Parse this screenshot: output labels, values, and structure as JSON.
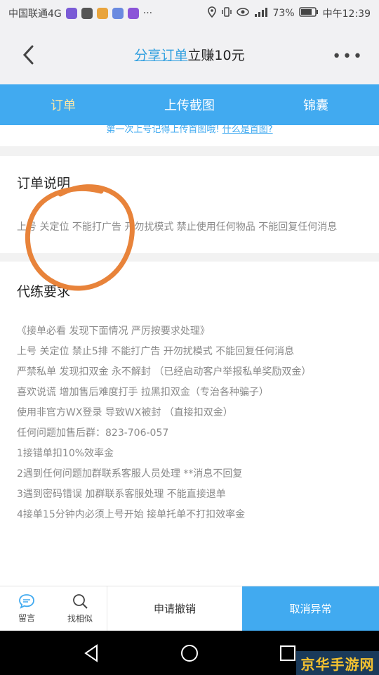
{
  "status_bar": {
    "carrier": "中国联通4G",
    "dots": "···",
    "battery": "73%",
    "time": "中午12:39"
  },
  "header": {
    "title_link": "分享订单",
    "title_rest": "立赚10元",
    "more": "•••"
  },
  "tabs": [
    {
      "label": "订单"
    },
    {
      "label": "上传截图"
    },
    {
      "label": "锦囊"
    }
  ],
  "hint": {
    "text": "第一次上号记得上传首图哦!",
    "link": "什么是首图?"
  },
  "order_note": {
    "heading": "订单说明",
    "body": "上号 关定位 不能打广告 开勿扰模式 禁止使用任何物品 不能回复任何消息"
  },
  "requirements": {
    "heading": "代练要求",
    "items": [
      "《接单必看 发现下面情况 严厉按要求处理》",
      "上号 关定位 禁止5排 不能打广告 开勿扰模式 不能回复任何消息",
      "严禁私单 发现扣双金 永不解封 （已经启动客户举报私单奖励双金）",
      "喜欢说谎 增加售后难度打手 拉黑扣双金（专治各种骗子）",
      "使用非官方WX登录 导致WX被封 （直接扣双金）",
      "任何问题加售后群：823-706-057",
      "1接错单扣10%效率金",
      "2遇到任何问题加群联系客服人员处理 **消息不回复",
      "3遇到密码错误 加群联系客服处理 不能直接退单",
      "4接单15分钟内必须上号开始 接单托单不打扣效率金"
    ]
  },
  "actions": {
    "comment": "留言",
    "find_similar": "找相似",
    "apply_cancel": "申请撤销",
    "cancel_abnormal": "取消异常"
  },
  "colors": {
    "accent": "#41aaf0",
    "annotation": "#e8833a"
  },
  "watermark": "京华手游网"
}
